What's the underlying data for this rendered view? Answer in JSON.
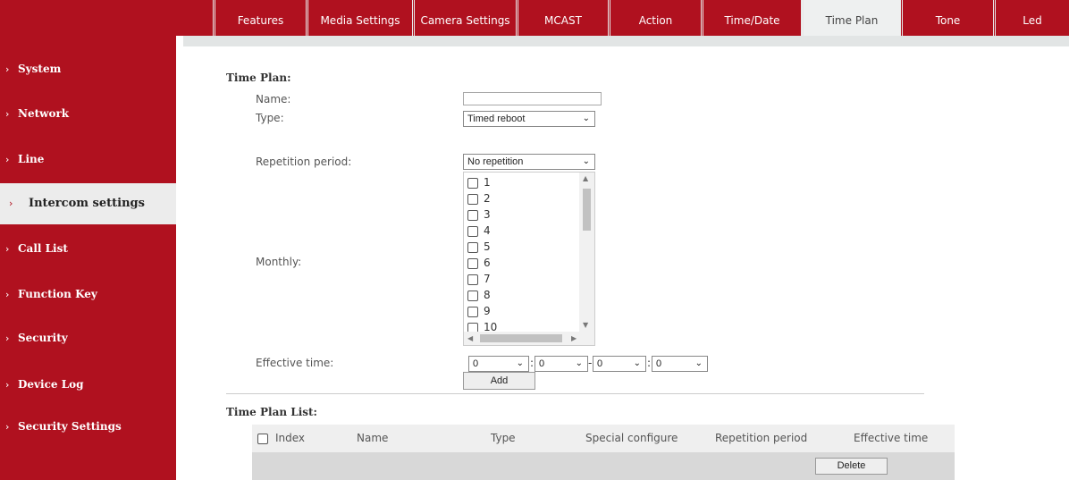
{
  "tabs": [
    {
      "label": "Features",
      "active": false
    },
    {
      "label": "Media Settings",
      "active": false
    },
    {
      "label": "Camera Settings",
      "active": false
    },
    {
      "label": "MCAST",
      "active": false
    },
    {
      "label": "Action",
      "active": false
    },
    {
      "label": "Time/Date",
      "active": false
    },
    {
      "label": "Time Plan",
      "active": true
    },
    {
      "label": "Tone",
      "active": false
    },
    {
      "label": "Led",
      "active": false
    }
  ],
  "sidebar": {
    "items": [
      {
        "label": "System"
      },
      {
        "label": "Network"
      },
      {
        "label": "Line"
      },
      {
        "label": "Intercom settings",
        "active": true
      },
      {
        "label": "Call List"
      },
      {
        "label": "Function Key"
      },
      {
        "label": "Security"
      },
      {
        "label": "Device Log"
      },
      {
        "label": "Security Settings"
      }
    ]
  },
  "form": {
    "section_title": "Time Plan:",
    "name_label": "Name:",
    "name_value": "",
    "type_label": "Type:",
    "type_value": "Timed reboot",
    "repetition_label": "Repetition period:",
    "repetition_value": "No repetition",
    "monthly_label": "Monthly:",
    "monthly_days": [
      "1",
      "2",
      "3",
      "4",
      "5",
      "6",
      "7",
      "8",
      "9",
      "10"
    ],
    "effective_label": "Effective time:",
    "time_values": [
      "0",
      "0",
      "0",
      "0"
    ],
    "add_label": "Add"
  },
  "list": {
    "section_title": "Time Plan List:",
    "columns": [
      "Index",
      "Name",
      "Type",
      "Special configure",
      "Repetition period",
      "Effective time"
    ],
    "delete_label": "Delete"
  },
  "colors": {
    "brand_red": "#b0111f",
    "active_tab_bg": "#eef0f0"
  }
}
